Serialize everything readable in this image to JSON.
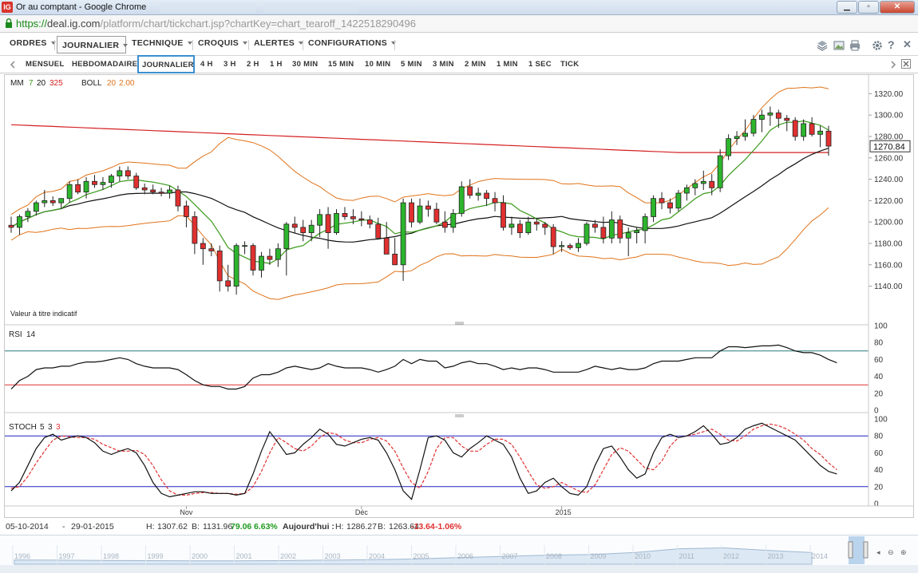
{
  "browser": {
    "title": "Or au comptant - Google Chrome",
    "logo": "IG",
    "url_scheme": "https://",
    "url_host": "deal.ig.com",
    "url_path": "/platform/chart/tickchart.jsp?chartKey=chart_tearoff_1422518290496",
    "buttons": [
      "minimize-icon",
      "maximize-icon",
      "close-icon"
    ]
  },
  "menubar": {
    "items": [
      "ORDRES",
      "JOURNALIER",
      "TECHNIQUE",
      "CROQUIS",
      "ALERTES",
      "CONFIGURATIONS"
    ],
    "active": "JOURNALIER",
    "tools": [
      "layers-icon",
      "image-icon",
      "print-icon",
      "settings-icon",
      "help-icon",
      "close-icon"
    ]
  },
  "intervals": {
    "items": [
      "MENSUEL",
      "HEBDOMADAIRE",
      "JOURNALIER",
      "4 H",
      "3 H",
      "2 H",
      "1 H",
      "30 MIN",
      "15 MIN",
      "10 MIN",
      "5 MIN",
      "3 MIN",
      "2 MIN",
      "1 MIN",
      "1 SEC",
      "TICK"
    ],
    "active": "JOURNALIER"
  },
  "indicators": {
    "mm": {
      "label": "MM",
      "p1": "7",
      "p2": "20",
      "p3": "325"
    },
    "boll": {
      "label": "BOLL",
      "p1": "20",
      "p2": "2.00"
    },
    "rsi": {
      "label": "RSI",
      "p": "14"
    },
    "stoch": {
      "label": "STOCH",
      "p1": "5",
      "p2": "3",
      "p3": "3"
    },
    "note": "Valeur à titre indicatif"
  },
  "colors": {
    "up": "#2db52d",
    "down": "#e03030",
    "mm7": "#3a9a1a",
    "mm20": "#111111",
    "mm325": "#d42020",
    "boll": "#e0731a",
    "rsi_upper": "#2a7a7a",
    "rsi_lower": "#e03030",
    "stoch_band": "#2020c0"
  },
  "chart_data": [
    {
      "type": "candlestick",
      "name": "price",
      "ylim": [
        1130,
        1330
      ],
      "yticks": [
        "1320.00",
        "1300.00",
        "1280.00",
        "1260.00",
        "1240.00",
        "1220.00",
        "1200.00",
        "1180.00",
        "1160.00",
        "1140.00"
      ],
      "current": "1270.84",
      "x_labels": [
        {
          "label": "Nov",
          "index": 21
        },
        {
          "label": "Déc",
          "index": 42
        },
        {
          "label": "2015",
          "index": 66
        }
      ],
      "candles": [
        [
          1197,
          1205,
          1190,
          1195
        ],
        [
          1195,
          1207,
          1188,
          1205
        ],
        [
          1205,
          1213,
          1200,
          1210
        ],
        [
          1210,
          1220,
          1206,
          1218
        ],
        [
          1218,
          1230,
          1214,
          1220
        ],
        [
          1220,
          1224,
          1215,
          1218
        ],
        [
          1218,
          1222,
          1212,
          1222
        ],
        [
          1222,
          1238,
          1218,
          1235
        ],
        [
          1235,
          1240,
          1226,
          1228
        ],
        [
          1228,
          1242,
          1222,
          1238
        ],
        [
          1238,
          1244,
          1232,
          1235
        ],
        [
          1235,
          1242,
          1230,
          1237
        ],
        [
          1237,
          1245,
          1232,
          1243
        ],
        [
          1243,
          1252,
          1238,
          1248
        ],
        [
          1248,
          1252,
          1240,
          1243
        ],
        [
          1243,
          1246,
          1230,
          1232
        ],
        [
          1232,
          1236,
          1226,
          1230
        ],
        [
          1230,
          1235,
          1226,
          1228
        ],
        [
          1228,
          1232,
          1224,
          1227
        ],
        [
          1227,
          1234,
          1222,
          1230
        ],
        [
          1230,
          1234,
          1210,
          1215
        ],
        [
          1215,
          1220,
          1195,
          1205
        ],
        [
          1205,
          1210,
          1170,
          1180
        ],
        [
          1180,
          1185,
          1160,
          1175
        ],
        [
          1175,
          1180,
          1168,
          1173
        ],
        [
          1173,
          1178,
          1135,
          1145
        ],
        [
          1145,
          1160,
          1135,
          1140
        ],
        [
          1140,
          1180,
          1132,
          1178
        ],
        [
          1178,
          1182,
          1170,
          1178
        ],
        [
          1178,
          1180,
          1150,
          1155
        ],
        [
          1155,
          1172,
          1148,
          1168
        ],
        [
          1168,
          1175,
          1160,
          1165
        ],
        [
          1165,
          1180,
          1158,
          1175
        ],
        [
          1175,
          1200,
          1150,
          1198
        ],
        [
          1198,
          1205,
          1190,
          1195
        ],
        [
          1195,
          1202,
          1182,
          1190
        ],
        [
          1190,
          1202,
          1182,
          1197
        ],
        [
          1197,
          1212,
          1186,
          1207
        ],
        [
          1207,
          1214,
          1175,
          1190
        ],
        [
          1190,
          1212,
          1188,
          1208
        ],
        [
          1208,
          1214,
          1202,
          1205
        ],
        [
          1205,
          1212,
          1198,
          1203
        ],
        [
          1203,
          1210,
          1196,
          1202
        ],
        [
          1202,
          1206,
          1194,
          1198
        ],
        [
          1198,
          1204,
          1185,
          1185
        ],
        [
          1185,
          1200,
          1175,
          1170
        ],
        [
          1170,
          1185,
          1160,
          1160
        ],
        [
          1160,
          1222,
          1145,
          1218
        ],
        [
          1218,
          1222,
          1195,
          1200
        ],
        [
          1200,
          1222,
          1198,
          1215
        ],
        [
          1215,
          1220,
          1205,
          1212
        ],
        [
          1212,
          1218,
          1198,
          1200
        ],
        [
          1200,
          1210,
          1190,
          1195
        ],
        [
          1195,
          1212,
          1190,
          1208
        ],
        [
          1208,
          1238,
          1205,
          1233
        ],
        [
          1233,
          1240,
          1222,
          1225
        ],
        [
          1225,
          1232,
          1220,
          1227
        ],
        [
          1227,
          1230,
          1215,
          1222
        ],
        [
          1222,
          1228,
          1210,
          1218
        ],
        [
          1218,
          1225,
          1192,
          1195
        ],
        [
          1195,
          1205,
          1188,
          1198
        ],
        [
          1198,
          1202,
          1185,
          1190
        ],
        [
          1190,
          1205,
          1188,
          1200
        ],
        [
          1200,
          1204,
          1192,
          1198
        ],
        [
          1198,
          1200,
          1188,
          1195
        ],
        [
          1195,
          1198,
          1170,
          1177
        ],
        [
          1177,
          1182,
          1172,
          1178
        ],
        [
          1178,
          1180,
          1174,
          1176
        ],
        [
          1176,
          1185,
          1172,
          1180
        ],
        [
          1180,
          1200,
          1178,
          1198
        ],
        [
          1198,
          1202,
          1190,
          1195
        ],
        [
          1195,
          1205,
          1180,
          1185
        ],
        [
          1185,
          1210,
          1180,
          1202
        ],
        [
          1202,
          1206,
          1180,
          1185
        ],
        [
          1185,
          1195,
          1168,
          1190
        ],
        [
          1190,
          1195,
          1180,
          1192
        ],
        [
          1192,
          1208,
          1180,
          1205
        ],
        [
          1205,
          1225,
          1200,
          1222
        ],
        [
          1222,
          1228,
          1212,
          1218
        ],
        [
          1218,
          1222,
          1208,
          1213
        ],
        [
          1213,
          1230,
          1210,
          1227
        ],
        [
          1227,
          1235,
          1220,
          1232
        ],
        [
          1232,
          1240,
          1225,
          1236
        ],
        [
          1236,
          1248,
          1230,
          1238
        ],
        [
          1238,
          1245,
          1225,
          1232
        ],
        [
          1232,
          1268,
          1228,
          1262
        ],
        [
          1262,
          1282,
          1258,
          1278
        ],
        [
          1278,
          1285,
          1272,
          1280
        ],
        [
          1280,
          1296,
          1276,
          1283
        ],
        [
          1283,
          1300,
          1280,
          1296
        ],
        [
          1296,
          1305,
          1284,
          1300
        ],
        [
          1300,
          1308,
          1290,
          1302
        ],
        [
          1302,
          1305,
          1288,
          1297
        ],
        [
          1297,
          1300,
          1285,
          1295
        ],
        [
          1295,
          1298,
          1276,
          1280
        ],
        [
          1280,
          1296,
          1276,
          1292
        ],
        [
          1292,
          1298,
          1280,
          1282
        ],
        [
          1282,
          1290,
          1270,
          1285
        ],
        [
          1285,
          1290,
          1262,
          1271
        ]
      ]
    },
    {
      "type": "line",
      "name": "rsi",
      "ylim": [
        0,
        100
      ],
      "yticks": [
        "100",
        "80",
        "60",
        "40",
        "20",
        "0"
      ],
      "levels": [
        70,
        30
      ],
      "values": [
        25,
        35,
        40,
        48,
        50,
        50,
        52,
        52,
        55,
        57,
        57,
        58,
        60,
        62,
        60,
        55,
        52,
        50,
        50,
        50,
        48,
        42,
        35,
        30,
        28,
        28,
        25,
        25,
        28,
        38,
        42,
        42,
        45,
        50,
        52,
        50,
        48,
        50,
        55,
        52,
        50,
        50,
        50,
        48,
        45,
        48,
        52,
        60,
        55,
        60,
        58,
        58,
        50,
        52,
        56,
        58,
        55,
        55,
        52,
        48,
        50,
        48,
        50,
        50,
        48,
        45,
        45,
        45,
        45,
        48,
        52,
        50,
        48,
        50,
        48,
        48,
        50,
        55,
        58,
        58,
        58,
        60,
        62,
        62,
        62,
        70,
        75,
        75,
        74,
        75,
        76,
        76,
        77,
        74,
        70,
        68,
        68,
        65,
        60,
        56
      ]
    },
    {
      "type": "line",
      "name": "stoch",
      "ylim": [
        0,
        100
      ],
      "yticks": [
        "100",
        "80",
        "60",
        "40",
        "20",
        "0"
      ],
      "levels": [
        80,
        20
      ],
      "k": [
        15,
        25,
        45,
        65,
        78,
        82,
        75,
        78,
        80,
        78,
        72,
        62,
        58,
        62,
        65,
        60,
        45,
        25,
        12,
        8,
        10,
        12,
        14,
        14,
        12,
        12,
        12,
        10,
        12,
        35,
        62,
        85,
        72,
        58,
        60,
        70,
        78,
        88,
        82,
        70,
        68,
        72,
        76,
        78,
        75,
        60,
        40,
        15,
        5,
        40,
        78,
        80,
        75,
        60,
        55,
        65,
        72,
        80,
        75,
        70,
        55,
        30,
        12,
        15,
        25,
        30,
        20,
        12,
        10,
        20,
        45,
        65,
        68,
        55,
        40,
        30,
        35,
        60,
        78,
        82,
        78,
        80,
        85,
        92,
        82,
        70,
        72,
        78,
        88,
        92,
        95,
        90,
        85,
        80,
        75,
        65,
        55,
        45,
        38,
        35
      ],
      "d": [
        18,
        20,
        32,
        48,
        62,
        75,
        80,
        79,
        78,
        78,
        76,
        70,
        66,
        62,
        62,
        63,
        58,
        45,
        28,
        15,
        10,
        10,
        12,
        13,
        13,
        12,
        12,
        11,
        12,
        20,
        38,
        60,
        78,
        72,
        65,
        62,
        68,
        78,
        84,
        82,
        75,
        72,
        72,
        76,
        78,
        74,
        62,
        42,
        25,
        18,
        38,
        65,
        78,
        78,
        68,
        62,
        62,
        70,
        76,
        76,
        70,
        55,
        38,
        22,
        18,
        20,
        25,
        20,
        15,
        13,
        22,
        40,
        58,
        66,
        62,
        52,
        42,
        40,
        50,
        68,
        78,
        80,
        82,
        85,
        88,
        82,
        75,
        74,
        80,
        88,
        92,
        94,
        92,
        88,
        82,
        75,
        65,
        58,
        48,
        40
      ]
    }
  ],
  "status": {
    "from_date": "05-10-2014",
    "to_date": "29-01-2015",
    "high_label": "H:",
    "high": "1307.62",
    "low_label": "B:",
    "low": "1131.96",
    "change": "79.06",
    "change_pct": "6.63%",
    "today_label": "Aujourd'hui :",
    "today_high_label": "H:",
    "today_high": "1286.27",
    "today_low_label": "B:",
    "today_low": "1263.64",
    "today_change": "-13.64",
    "today_change_pct": "-1.06%"
  },
  "navigator": {
    "years": [
      "1996",
      "1997",
      "1998",
      "1999",
      "2000",
      "2001",
      "2002",
      "2003",
      "2004",
      "2005",
      "2006",
      "2007",
      "2008",
      "2009",
      "2010",
      "2011",
      "2012",
      "2013",
      "2014"
    ],
    "history": [
      0.12,
      0.11,
      0.1,
      0.09,
      0.08,
      0.08,
      0.09,
      0.11,
      0.13,
      0.16,
      0.22,
      0.28,
      0.33,
      0.36,
      0.45,
      0.62,
      0.66,
      0.55,
      0.45
    ]
  }
}
